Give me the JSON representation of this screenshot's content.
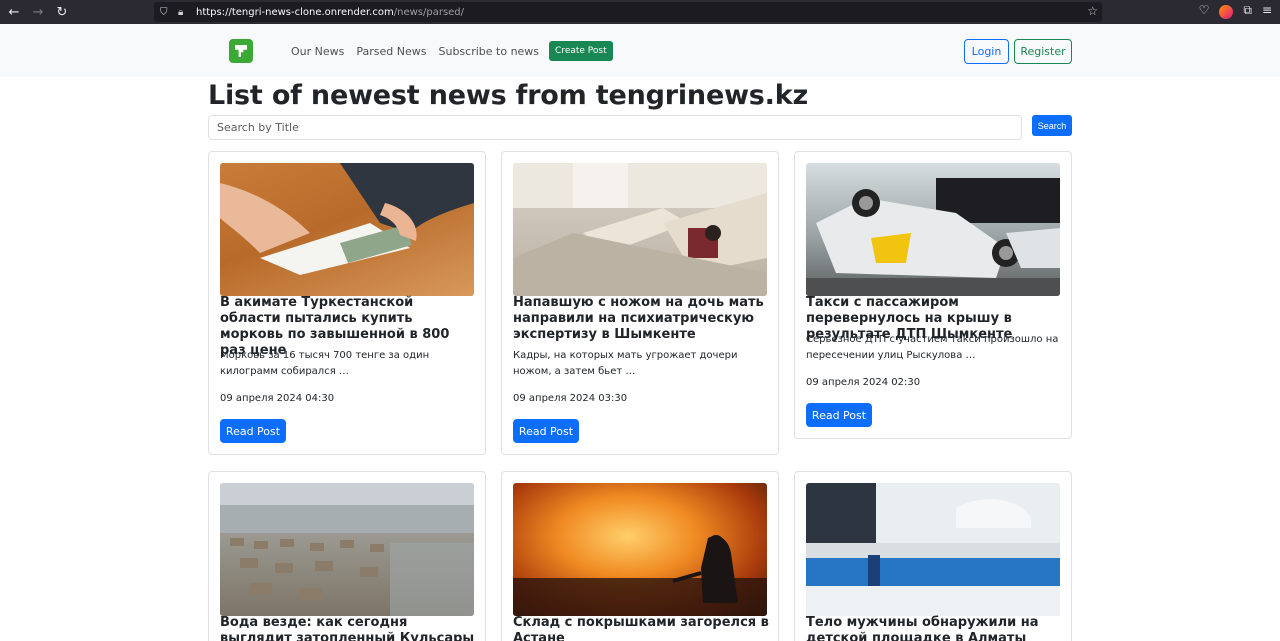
{
  "browser": {
    "url_host": "https://tengri-news-clone.onrender.com",
    "url_path": "/news/parsed/"
  },
  "navbar": {
    "links": [
      "Our News",
      "Parsed News",
      "Subscribe to news"
    ],
    "create_post": "Create Post",
    "login": "Login",
    "register": "Register"
  },
  "page": {
    "title": "List of newest news from tengrinews.kz",
    "search_placeholder": "Search by Title",
    "search_button": "Search"
  },
  "cards": [
    {
      "title": "В акимате Туркестанской области пытались купить морковь по завышенной в 800 раз цене",
      "text": "Морковь за 16 тысяч 700 тенге за один килограмм собирался …",
      "date": "09 апреля 2024 04:30",
      "button": "Read Post"
    },
    {
      "title": "Напавшую с ножом на дочь мать направили на психиатрическую экспертизу в Шымкенте",
      "text": "Кадры, на которых мать угрожает дочери ножом, а затем бьет …",
      "date": "09 апреля 2024 03:30",
      "button": "Read Post"
    },
    {
      "title": "Такси с пассажиром перевернулось на крышу в результате ДТП Шымкенте",
      "text": "Серьезное ДТП с участием такси произошло на пересечении улиц Рыскулова …",
      "date": "09 апреля 2024 02:30",
      "button": "Read Post"
    },
    {
      "title": "Вода везде: как сегодня выглядит затопленный Кульсары"
    },
    {
      "title": "Склад с покрышками загорелся в Астане"
    },
    {
      "title": "Тело мужчины обнаружили на детской площадке в Алматы"
    }
  ]
}
